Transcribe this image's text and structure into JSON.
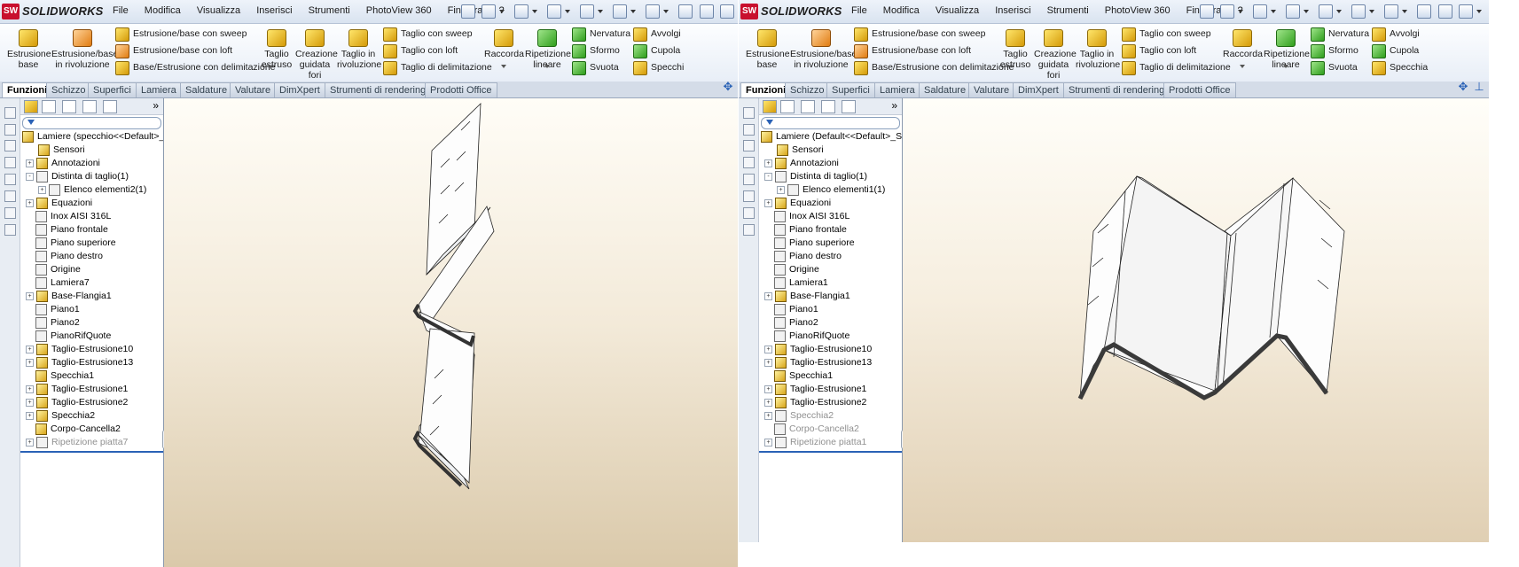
{
  "left": {
    "logo": "SOLIDWORKS",
    "menus": [
      "File",
      "Modifica",
      "Visualizza",
      "Inserisci",
      "Strumenti",
      "PhotoView 360",
      "Finestra",
      "?"
    ],
    "ribbon": {
      "big": [
        {
          "l1": "Estrusione",
          "l2": "base",
          "l3": ""
        },
        {
          "l1": "Estrusione/base",
          "l2": "in rivoluzione",
          "l3": ""
        },
        {
          "l1": "Taglio",
          "l2": "estruso",
          "l3": ""
        },
        {
          "l1": "Creazione",
          "l2": "guidata",
          "l3": "fori"
        },
        {
          "l1": "Taglio in",
          "l2": "rivoluzione",
          "l3": ""
        },
        {
          "l1": "Raccorda",
          "l2": "",
          "l3": ""
        },
        {
          "l1": "Ripetizione",
          "l2": "lineare",
          "l3": ""
        }
      ],
      "small": [
        "Estrusione/base con sweep",
        "Estrusione/base con loft",
        "Base/Estrusione con delimitazione",
        "Taglio con sweep",
        "Taglio con loft",
        "Taglio di delimitazione",
        "Nervatura",
        "Sformo",
        "Svuota",
        "Avvolgi",
        "Cupola",
        "Specchi"
      ]
    },
    "tabs": [
      "Funzioni",
      "Schizzo",
      "Superfici",
      "Lamiera",
      "Saldature",
      "Valutare",
      "DimXpert",
      "Strumenti di rendering",
      "Prodotti Office"
    ],
    "root": "Lamiere  (specchio<<Default>_S",
    "tree": [
      "Sensori",
      "Annotazioni",
      "Distinta di taglio(1)",
      "Elenco elementi2(1)",
      "Equazioni",
      "Inox AISI 316L",
      "Piano frontale",
      "Piano superiore",
      "Piano destro",
      "Origine",
      "Lamiera7",
      "Base-Flangia1",
      "Piano1",
      "Piano2",
      "PianoRifQuote",
      "Taglio-Estrusione10",
      "Taglio-Estrusione13",
      "Specchia1",
      "Taglio-Estrusione1",
      "Taglio-Estrusione2",
      "Specchia2",
      "Corpo-Cancella2",
      "Ripetizione piatta7"
    ]
  },
  "right": {
    "logo": "SOLIDWORKS",
    "menus": [
      "File",
      "Modifica",
      "Visualizza",
      "Inserisci",
      "Strumenti",
      "PhotoView 360",
      "Finestra",
      "?"
    ],
    "ribbon": {
      "big": [
        {
          "l1": "Estrusione",
          "l2": "base",
          "l3": ""
        },
        {
          "l1": "Estrusione/base",
          "l2": "in rivoluzione",
          "l3": ""
        },
        {
          "l1": "Taglio",
          "l2": "estruso",
          "l3": ""
        },
        {
          "l1": "Creazione",
          "l2": "guidata",
          "l3": "fori"
        },
        {
          "l1": "Taglio in",
          "l2": "rivoluzione",
          "l3": ""
        },
        {
          "l1": "Raccorda",
          "l2": "",
          "l3": ""
        },
        {
          "l1": "Ripetizione",
          "l2": "lineare",
          "l3": ""
        }
      ],
      "small": [
        "Estrusione/base con sweep",
        "Estrusione/base con loft",
        "Base/Estrusione con delimitazione",
        "Taglio con sweep",
        "Taglio con loft",
        "Taglio di delimitazione",
        "Nervatura",
        "Sformo",
        "Svuota",
        "Avvolgi",
        "Cupola",
        "Specchia"
      ]
    },
    "tabs": [
      "Funzioni",
      "Schizzo",
      "Superfici",
      "Lamiera",
      "Saldature",
      "Valutare",
      "DimXpert",
      "Strumenti di rendering",
      "Prodotti Office"
    ],
    "root": "Lamiere  (Default<<Default>_Sta",
    "tree": [
      "Sensori",
      "Annotazioni",
      "Distinta di taglio(1)",
      "Elenco elementi1(1)",
      "Equazioni",
      "Inox AISI 316L",
      "Piano frontale",
      "Piano superiore",
      "Piano destro",
      "Origine",
      "Lamiera1",
      "Base-Flangia1",
      "Piano1",
      "Piano2",
      "PianoRifQuote",
      "Taglio-Estrusione10",
      "Taglio-Estrusione13",
      "Specchia1",
      "Taglio-Estrusione1",
      "Taglio-Estrusione2",
      "Specchia2",
      "Corpo-Cancella2",
      "Ripetizione piatta1"
    ]
  },
  "colors": {
    "accent": "#2a62b6",
    "brand": "#c8102e"
  }
}
